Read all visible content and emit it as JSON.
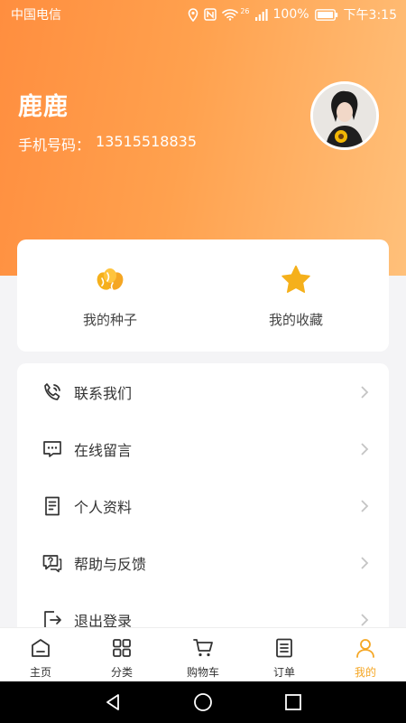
{
  "status_bar": {
    "carrier": "中国电信",
    "network_badge": "26",
    "battery": "100%",
    "time": "下午3:15"
  },
  "profile": {
    "name": "鹿鹿",
    "phone_label": "手机号码：",
    "phone_number": "13515518835"
  },
  "quick_actions": [
    {
      "label": "我的种子",
      "icon": "seeds-icon"
    },
    {
      "label": "我的收藏",
      "icon": "star-icon"
    }
  ],
  "menu": [
    {
      "label": "联系我们",
      "icon": "phone-call-icon"
    },
    {
      "label": "在线留言",
      "icon": "message-icon"
    },
    {
      "label": "个人资料",
      "icon": "document-icon"
    },
    {
      "label": "帮助与反馈",
      "icon": "help-chat-icon"
    },
    {
      "label": "退出登录",
      "icon": "logout-icon"
    }
  ],
  "tabbar": [
    {
      "label": "主页",
      "icon": "home-icon",
      "active": false
    },
    {
      "label": "分类",
      "icon": "grid-icon",
      "active": false
    },
    {
      "label": "购物车",
      "icon": "cart-icon",
      "active": false
    },
    {
      "label": "订单",
      "icon": "order-icon",
      "active": false
    },
    {
      "label": "我的",
      "icon": "user-icon",
      "active": true
    }
  ],
  "colors": {
    "accent": "#f5a623",
    "header_start": "#ff8e3f",
    "header_end": "#ffc07a"
  }
}
